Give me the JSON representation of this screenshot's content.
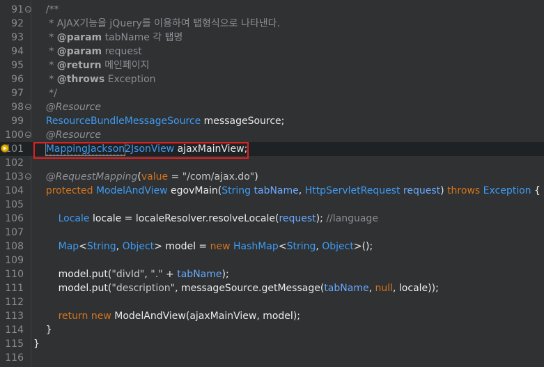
{
  "editor": {
    "lines": [
      {
        "n": "91",
        "fold": "minus",
        "tokens": [
          {
            "t": "    /**",
            "c": "c-comment"
          }
        ]
      },
      {
        "n": "92",
        "tokens": [
          {
            "t": "     * AJAX기능을 jQuery를 이용하여 탭형식으로 나타낸다.",
            "c": "c-comment"
          }
        ]
      },
      {
        "n": "93",
        "tokens": [
          {
            "t": "     * ",
            "c": "c-comment"
          },
          {
            "t": "@param",
            "c": "c-doctag"
          },
          {
            "t": " tabName 각 탭명",
            "c": "c-comment"
          }
        ]
      },
      {
        "n": "94",
        "tokens": [
          {
            "t": "     * ",
            "c": "c-comment"
          },
          {
            "t": "@param",
            "c": "c-doctag"
          },
          {
            "t": " request",
            "c": "c-comment"
          }
        ]
      },
      {
        "n": "95",
        "tokens": [
          {
            "t": "     * ",
            "c": "c-comment"
          },
          {
            "t": "@return",
            "c": "c-doctag"
          },
          {
            "t": " 메인페이지",
            "c": "c-comment"
          }
        ]
      },
      {
        "n": "96",
        "tokens": [
          {
            "t": "     * ",
            "c": "c-comment"
          },
          {
            "t": "@throws",
            "c": "c-doctag"
          },
          {
            "t": " Exception",
            "c": "c-comment"
          }
        ]
      },
      {
        "n": "97",
        "tokens": [
          {
            "t": "     */",
            "c": "c-comment"
          }
        ]
      },
      {
        "n": "98",
        "fold": "minus",
        "tokens": [
          {
            "t": "    @Resource",
            "c": "c-ann"
          }
        ]
      },
      {
        "n": "99",
        "tokens": [
          {
            "t": "    ",
            "c": ""
          },
          {
            "t": "ResourceBundleMessageSource",
            "c": "c-type"
          },
          {
            "t": " ",
            "c": ""
          },
          {
            "t": "messageSource",
            "c": "c-id"
          },
          {
            "t": ";",
            "c": "c-id"
          }
        ]
      },
      {
        "n": "100",
        "fold": "minus",
        "tokens": [
          {
            "t": "    @Resource",
            "c": "c-ann"
          }
        ]
      },
      {
        "n": "101",
        "marker": true,
        "current": true,
        "tokens": [
          {
            "t": "    ",
            "c": ""
          },
          {
            "t": "MappingJackson",
            "c": "c-type"
          },
          {
            "t": "2JsonView",
            "c": "c-type"
          },
          {
            "t": " ",
            "c": ""
          },
          {
            "t": "ajaxMainView",
            "c": "c-id"
          },
          {
            "t": ";",
            "c": "c-id"
          }
        ]
      },
      {
        "n": "102",
        "tokens": []
      },
      {
        "n": "103",
        "fold": "minus",
        "tokens": [
          {
            "t": "    @RequestMapping",
            "c": "c-ann"
          },
          {
            "t": "(",
            "c": "c-id"
          },
          {
            "t": "value",
            "c": "c-kw"
          },
          {
            "t": " = ",
            "c": "c-id"
          },
          {
            "t": "\"/com/ajax.do\"",
            "c": "c-str"
          },
          {
            "t": ")",
            "c": "c-id"
          }
        ]
      },
      {
        "n": "104",
        "tokens": [
          {
            "t": "    ",
            "c": ""
          },
          {
            "t": "protected",
            "c": "c-kw"
          },
          {
            "t": " ",
            "c": ""
          },
          {
            "t": "ModelAndView",
            "c": "c-type"
          },
          {
            "t": " ",
            "c": ""
          },
          {
            "t": "egovMain",
            "c": "c-id"
          },
          {
            "t": "(",
            "c": "c-id"
          },
          {
            "t": "String",
            "c": "c-type"
          },
          {
            "t": " ",
            "c": ""
          },
          {
            "t": "tabName",
            "c": "c-param"
          },
          {
            "t": ", ",
            "c": "c-id"
          },
          {
            "t": "HttpServletRequest",
            "c": "c-type"
          },
          {
            "t": " ",
            "c": ""
          },
          {
            "t": "request",
            "c": "c-param"
          },
          {
            "t": ") ",
            "c": "c-id"
          },
          {
            "t": "throws",
            "c": "c-kw"
          },
          {
            "t": " ",
            "c": ""
          },
          {
            "t": "Exception",
            "c": "c-type"
          },
          {
            "t": " {",
            "c": "c-id"
          }
        ]
      },
      {
        "n": "105",
        "tokens": []
      },
      {
        "n": "106",
        "tokens": [
          {
            "t": "        ",
            "c": ""
          },
          {
            "t": "Locale",
            "c": "c-type"
          },
          {
            "t": " ",
            "c": ""
          },
          {
            "t": "locale",
            "c": "c-var"
          },
          {
            "t": " = ",
            "c": "c-id"
          },
          {
            "t": "localeResolver",
            "c": "c-id"
          },
          {
            "t": ".",
            "c": "c-id"
          },
          {
            "t": "resolveLocale",
            "c": "c-id"
          },
          {
            "t": "(",
            "c": "c-id"
          },
          {
            "t": "request",
            "c": "c-param"
          },
          {
            "t": "); ",
            "c": "c-id"
          },
          {
            "t": "//language",
            "c": "c-comment"
          }
        ]
      },
      {
        "n": "107",
        "tokens": []
      },
      {
        "n": "108",
        "tokens": [
          {
            "t": "        ",
            "c": ""
          },
          {
            "t": "Map",
            "c": "c-type"
          },
          {
            "t": "<",
            "c": "c-id"
          },
          {
            "t": "String",
            "c": "c-type"
          },
          {
            "t": ", ",
            "c": "c-id"
          },
          {
            "t": "Object",
            "c": "c-type"
          },
          {
            "t": "> ",
            "c": "c-id"
          },
          {
            "t": "model",
            "c": "c-var"
          },
          {
            "t": " = ",
            "c": "c-id"
          },
          {
            "t": "new",
            "c": "c-kw"
          },
          {
            "t": " ",
            "c": ""
          },
          {
            "t": "HashMap",
            "c": "c-type"
          },
          {
            "t": "<",
            "c": "c-id"
          },
          {
            "t": "String",
            "c": "c-type"
          },
          {
            "t": ", ",
            "c": "c-id"
          },
          {
            "t": "Object",
            "c": "c-type"
          },
          {
            "t": ">();",
            "c": "c-id"
          }
        ]
      },
      {
        "n": "109",
        "tokens": []
      },
      {
        "n": "110",
        "tokens": [
          {
            "t": "        ",
            "c": ""
          },
          {
            "t": "model",
            "c": "c-var"
          },
          {
            "t": ".put(",
            "c": "c-id"
          },
          {
            "t": "\"divId\"",
            "c": "c-str"
          },
          {
            "t": ", ",
            "c": "c-id"
          },
          {
            "t": "\".\"",
            "c": "c-str"
          },
          {
            "t": " + ",
            "c": "c-id"
          },
          {
            "t": "tabName",
            "c": "c-param"
          },
          {
            "t": ");",
            "c": "c-id"
          }
        ]
      },
      {
        "n": "111",
        "tokens": [
          {
            "t": "        ",
            "c": ""
          },
          {
            "t": "model",
            "c": "c-var"
          },
          {
            "t": ".put(",
            "c": "c-id"
          },
          {
            "t": "\"description\"",
            "c": "c-str"
          },
          {
            "t": ", ",
            "c": "c-id"
          },
          {
            "t": "messageSource",
            "c": "c-id"
          },
          {
            "t": ".",
            "c": "c-id"
          },
          {
            "t": "getMessage",
            "c": "c-id"
          },
          {
            "t": "(",
            "c": "c-id"
          },
          {
            "t": "tabName",
            "c": "c-param"
          },
          {
            "t": ", ",
            "c": "c-id"
          },
          {
            "t": "null",
            "c": "c-null"
          },
          {
            "t": ", ",
            "c": "c-id"
          },
          {
            "t": "locale",
            "c": "c-var"
          },
          {
            "t": "));",
            "c": "c-id"
          }
        ]
      },
      {
        "n": "112",
        "tokens": []
      },
      {
        "n": "113",
        "tokens": [
          {
            "t": "        ",
            "c": ""
          },
          {
            "t": "return",
            "c": "c-kw"
          },
          {
            "t": " ",
            "c": ""
          },
          {
            "t": "new",
            "c": "c-kw"
          },
          {
            "t": " ",
            "c": ""
          },
          {
            "t": "ModelAndView",
            "c": "c-id"
          },
          {
            "t": "(",
            "c": "c-id"
          },
          {
            "t": "ajaxMainView",
            "c": "c-id"
          },
          {
            "t": ", ",
            "c": "c-id"
          },
          {
            "t": "model",
            "c": "c-var"
          },
          {
            "t": ");",
            "c": "c-id"
          }
        ]
      },
      {
        "n": "114",
        "tokens": [
          {
            "t": "    }",
            "c": "c-id"
          }
        ]
      },
      {
        "n": "115",
        "tokens": [
          {
            "t": "}",
            "c": "c-id"
          }
        ]
      },
      {
        "n": "116",
        "tokens": []
      }
    ]
  },
  "colors": {
    "background": "#2f3133",
    "keyword": "#d5751d",
    "type": "#3f9bf2",
    "comment": "#8a8f94",
    "highlight_border": "#e02020"
  }
}
